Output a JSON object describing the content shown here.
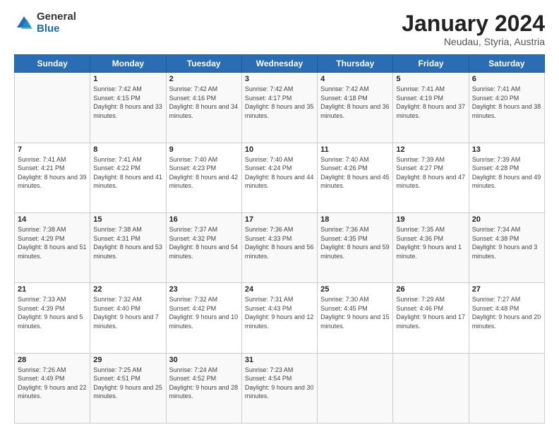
{
  "logo": {
    "general": "General",
    "blue": "Blue"
  },
  "header": {
    "title": "January 2024",
    "subtitle": "Neudau, Styria, Austria"
  },
  "days_of_week": [
    "Sunday",
    "Monday",
    "Tuesday",
    "Wednesday",
    "Thursday",
    "Friday",
    "Saturday"
  ],
  "weeks": [
    [
      {
        "day": "",
        "sunrise": "",
        "sunset": "",
        "daylight": ""
      },
      {
        "day": "1",
        "sunrise": "Sunrise: 7:42 AM",
        "sunset": "Sunset: 4:15 PM",
        "daylight": "Daylight: 8 hours and 33 minutes."
      },
      {
        "day": "2",
        "sunrise": "Sunrise: 7:42 AM",
        "sunset": "Sunset: 4:16 PM",
        "daylight": "Daylight: 8 hours and 34 minutes."
      },
      {
        "day": "3",
        "sunrise": "Sunrise: 7:42 AM",
        "sunset": "Sunset: 4:17 PM",
        "daylight": "Daylight: 8 hours and 35 minutes."
      },
      {
        "day": "4",
        "sunrise": "Sunrise: 7:42 AM",
        "sunset": "Sunset: 4:18 PM",
        "daylight": "Daylight: 8 hours and 36 minutes."
      },
      {
        "day": "5",
        "sunrise": "Sunrise: 7:41 AM",
        "sunset": "Sunset: 4:19 PM",
        "daylight": "Daylight: 8 hours and 37 minutes."
      },
      {
        "day": "6",
        "sunrise": "Sunrise: 7:41 AM",
        "sunset": "Sunset: 4:20 PM",
        "daylight": "Daylight: 8 hours and 38 minutes."
      }
    ],
    [
      {
        "day": "7",
        "sunrise": "Sunrise: 7:41 AM",
        "sunset": "Sunset: 4:21 PM",
        "daylight": "Daylight: 8 hours and 39 minutes."
      },
      {
        "day": "8",
        "sunrise": "Sunrise: 7:41 AM",
        "sunset": "Sunset: 4:22 PM",
        "daylight": "Daylight: 8 hours and 41 minutes."
      },
      {
        "day": "9",
        "sunrise": "Sunrise: 7:40 AM",
        "sunset": "Sunset: 4:23 PM",
        "daylight": "Daylight: 8 hours and 42 minutes."
      },
      {
        "day": "10",
        "sunrise": "Sunrise: 7:40 AM",
        "sunset": "Sunset: 4:24 PM",
        "daylight": "Daylight: 8 hours and 44 minutes."
      },
      {
        "day": "11",
        "sunrise": "Sunrise: 7:40 AM",
        "sunset": "Sunset: 4:26 PM",
        "daylight": "Daylight: 8 hours and 45 minutes."
      },
      {
        "day": "12",
        "sunrise": "Sunrise: 7:39 AM",
        "sunset": "Sunset: 4:27 PM",
        "daylight": "Daylight: 8 hours and 47 minutes."
      },
      {
        "day": "13",
        "sunrise": "Sunrise: 7:39 AM",
        "sunset": "Sunset: 4:28 PM",
        "daylight": "Daylight: 8 hours and 49 minutes."
      }
    ],
    [
      {
        "day": "14",
        "sunrise": "Sunrise: 7:38 AM",
        "sunset": "Sunset: 4:29 PM",
        "daylight": "Daylight: 8 hours and 51 minutes."
      },
      {
        "day": "15",
        "sunrise": "Sunrise: 7:38 AM",
        "sunset": "Sunset: 4:31 PM",
        "daylight": "Daylight: 8 hours and 53 minutes."
      },
      {
        "day": "16",
        "sunrise": "Sunrise: 7:37 AM",
        "sunset": "Sunset: 4:32 PM",
        "daylight": "Daylight: 8 hours and 54 minutes."
      },
      {
        "day": "17",
        "sunrise": "Sunrise: 7:36 AM",
        "sunset": "Sunset: 4:33 PM",
        "daylight": "Daylight: 8 hours and 56 minutes."
      },
      {
        "day": "18",
        "sunrise": "Sunrise: 7:36 AM",
        "sunset": "Sunset: 4:35 PM",
        "daylight": "Daylight: 8 hours and 59 minutes."
      },
      {
        "day": "19",
        "sunrise": "Sunrise: 7:35 AM",
        "sunset": "Sunset: 4:36 PM",
        "daylight": "Daylight: 9 hours and 1 minute."
      },
      {
        "day": "20",
        "sunrise": "Sunrise: 7:34 AM",
        "sunset": "Sunset: 4:38 PM",
        "daylight": "Daylight: 9 hours and 3 minutes."
      }
    ],
    [
      {
        "day": "21",
        "sunrise": "Sunrise: 7:33 AM",
        "sunset": "Sunset: 4:39 PM",
        "daylight": "Daylight: 9 hours and 5 minutes."
      },
      {
        "day": "22",
        "sunrise": "Sunrise: 7:32 AM",
        "sunset": "Sunset: 4:40 PM",
        "daylight": "Daylight: 9 hours and 7 minutes."
      },
      {
        "day": "23",
        "sunrise": "Sunrise: 7:32 AM",
        "sunset": "Sunset: 4:42 PM",
        "daylight": "Daylight: 9 hours and 10 minutes."
      },
      {
        "day": "24",
        "sunrise": "Sunrise: 7:31 AM",
        "sunset": "Sunset: 4:43 PM",
        "daylight": "Daylight: 9 hours and 12 minutes."
      },
      {
        "day": "25",
        "sunrise": "Sunrise: 7:30 AM",
        "sunset": "Sunset: 4:45 PM",
        "daylight": "Daylight: 9 hours and 15 minutes."
      },
      {
        "day": "26",
        "sunrise": "Sunrise: 7:29 AM",
        "sunset": "Sunset: 4:46 PM",
        "daylight": "Daylight: 9 hours and 17 minutes."
      },
      {
        "day": "27",
        "sunrise": "Sunrise: 7:27 AM",
        "sunset": "Sunset: 4:48 PM",
        "daylight": "Daylight: 9 hours and 20 minutes."
      }
    ],
    [
      {
        "day": "28",
        "sunrise": "Sunrise: 7:26 AM",
        "sunset": "Sunset: 4:49 PM",
        "daylight": "Daylight: 9 hours and 22 minutes."
      },
      {
        "day": "29",
        "sunrise": "Sunrise: 7:25 AM",
        "sunset": "Sunset: 4:51 PM",
        "daylight": "Daylight: 9 hours and 25 minutes."
      },
      {
        "day": "30",
        "sunrise": "Sunrise: 7:24 AM",
        "sunset": "Sunset: 4:52 PM",
        "daylight": "Daylight: 9 hours and 28 minutes."
      },
      {
        "day": "31",
        "sunrise": "Sunrise: 7:23 AM",
        "sunset": "Sunset: 4:54 PM",
        "daylight": "Daylight: 9 hours and 30 minutes."
      },
      {
        "day": "",
        "sunrise": "",
        "sunset": "",
        "daylight": ""
      },
      {
        "day": "",
        "sunrise": "",
        "sunset": "",
        "daylight": ""
      },
      {
        "day": "",
        "sunrise": "",
        "sunset": "",
        "daylight": ""
      }
    ]
  ]
}
